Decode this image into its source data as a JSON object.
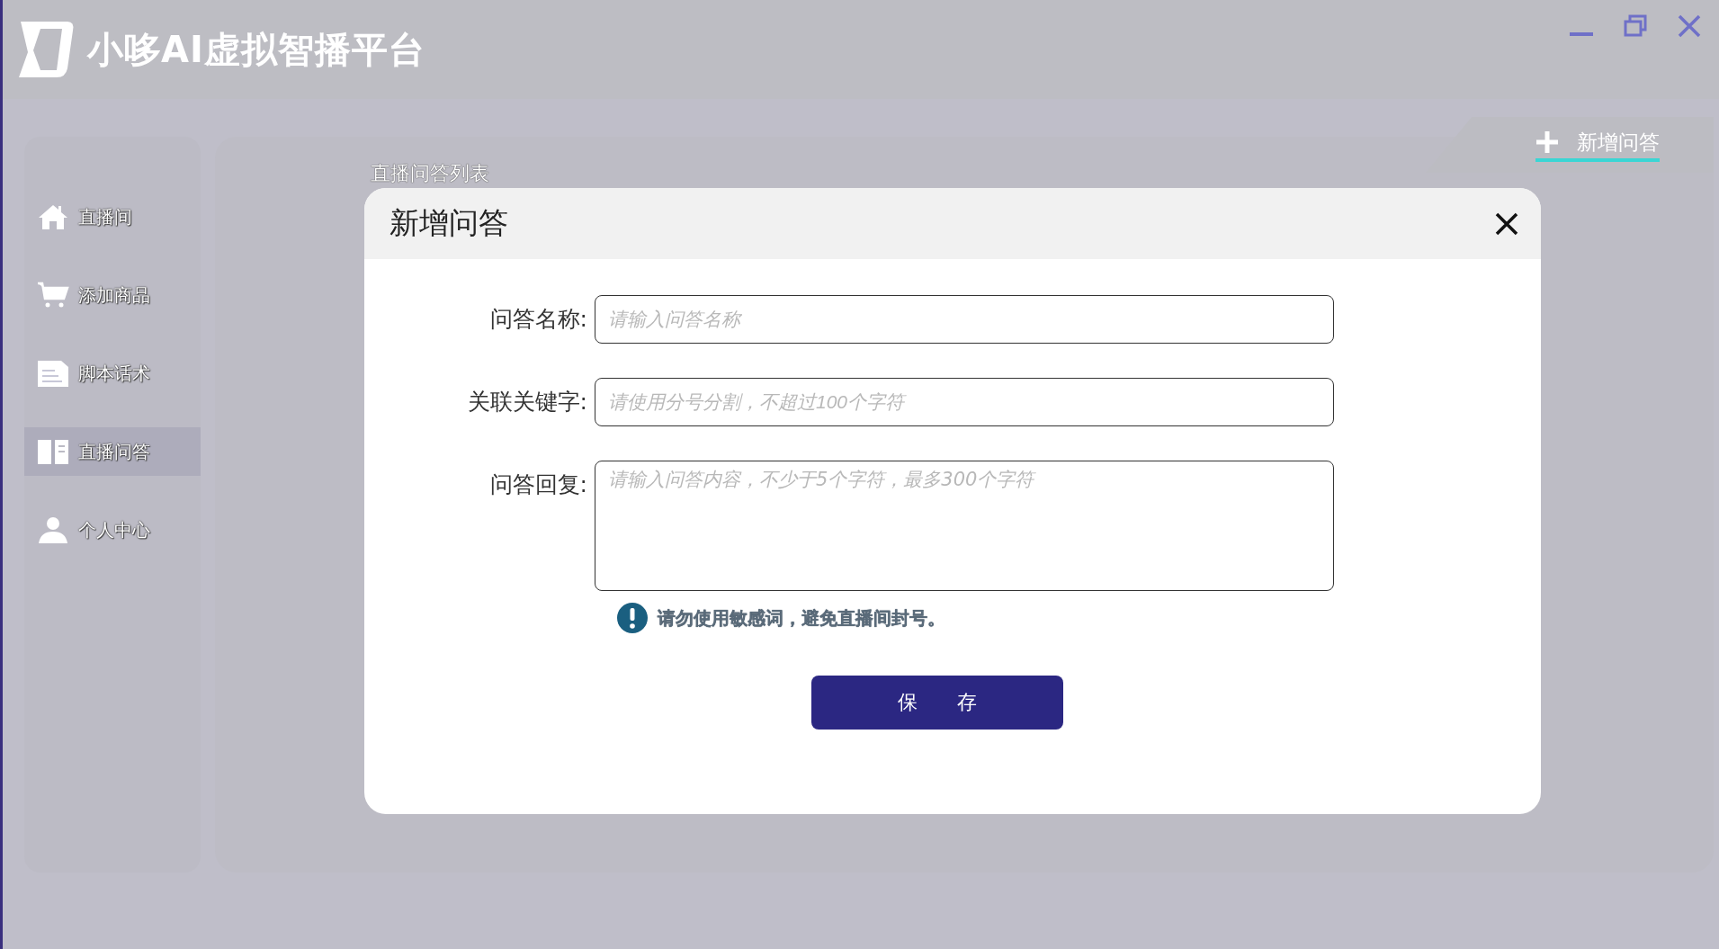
{
  "app": {
    "title": "小哆AI虚拟智播平台"
  },
  "sidebar": {
    "items": [
      {
        "label": "直播间",
        "selected": false
      },
      {
        "label": "添加商品",
        "selected": false
      },
      {
        "label": "脚本话术",
        "selected": false
      },
      {
        "label": "直播问答",
        "selected": true
      },
      {
        "label": "个人中心",
        "selected": false
      }
    ]
  },
  "page": {
    "heading": "直播问答列表",
    "add_button": "新增问答"
  },
  "dialog": {
    "title": "新增问答",
    "fields": [
      {
        "kind": "input",
        "label": "问答名称:",
        "placeholder": "请输入问答名称"
      },
      {
        "kind": "input",
        "label": "关联关键字:",
        "placeholder": "请使用分号分割，不超过100个字符"
      },
      {
        "kind": "textarea",
        "label": "问答回复:",
        "placeholder": "请输入问答内容，不少于5个字符，最多300个字符"
      }
    ],
    "notice": "请勿使用敏感词，避免直播间封号。",
    "save_button": "保　　存"
  }
}
